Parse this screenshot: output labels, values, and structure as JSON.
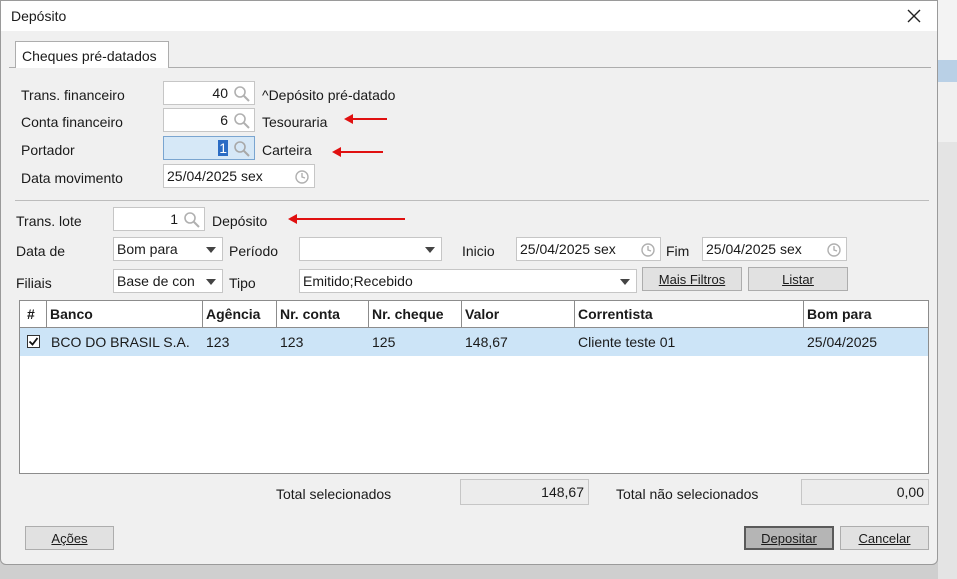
{
  "window": {
    "title": "Depósito"
  },
  "tabs": [
    {
      "label": "Cheques pré-datados"
    }
  ],
  "form": {
    "trans_financeiro": {
      "label": "Trans. financeiro",
      "value": "40",
      "desc": "^Depósito pré-datado"
    },
    "conta_financeiro": {
      "label": "Conta financeiro",
      "value": "6",
      "desc": "Tesouraria"
    },
    "portador": {
      "label": "Portador",
      "value": "1",
      "desc": "Carteira"
    },
    "data_movimento": {
      "label": "Data movimento",
      "value": "25/04/2025 sex"
    }
  },
  "filters": {
    "trans_lote": {
      "label": "Trans. lote",
      "value": "1",
      "desc": "Depósito"
    },
    "data_de": {
      "label": "Data de",
      "value": "Bom para"
    },
    "periodo": {
      "label": "Período",
      "value": ""
    },
    "inicio": {
      "label": "Inicio",
      "value": "25/04/2025 sex"
    },
    "fim": {
      "label": "Fim",
      "value": "25/04/2025 sex"
    },
    "filiais": {
      "label": "Filiais",
      "value": "Base de con"
    },
    "tipo": {
      "label": "Tipo",
      "value": "Emitido;Recebido"
    },
    "mais_filtros": "Mais Filtros",
    "listar": "Listar"
  },
  "grid": {
    "columns": [
      "#",
      "Banco",
      "Agência",
      "Nr. conta",
      "Nr. cheque",
      "Valor",
      "Correntista",
      "Bom para"
    ],
    "rows": [
      {
        "checked": true,
        "banco": "BCO DO BRASIL S.A.",
        "agencia": "123",
        "nr_conta": "123",
        "nr_cheque": "125",
        "valor": "148,67",
        "correntista": "Cliente teste 01",
        "bom_para": "25/04/2025"
      }
    ]
  },
  "totals": {
    "selecionados_label": "Total selecionados",
    "selecionados_value": "148,67",
    "nao_selecionados_label": "Total não selecionados",
    "nao_selecionados_value": "0,00"
  },
  "buttons": {
    "acoes": "Ações",
    "depositar": "Depositar",
    "cancelar": "Cancelar"
  },
  "colors": {
    "annotation_arrow": "#e01010",
    "row_highlight": "#cce4f7"
  },
  "icons": [
    "close-icon",
    "magnifier-icon",
    "clock-icon",
    "dropdown-arrow-icon",
    "checkbox-checked-icon",
    "red-arrow-icon"
  ]
}
